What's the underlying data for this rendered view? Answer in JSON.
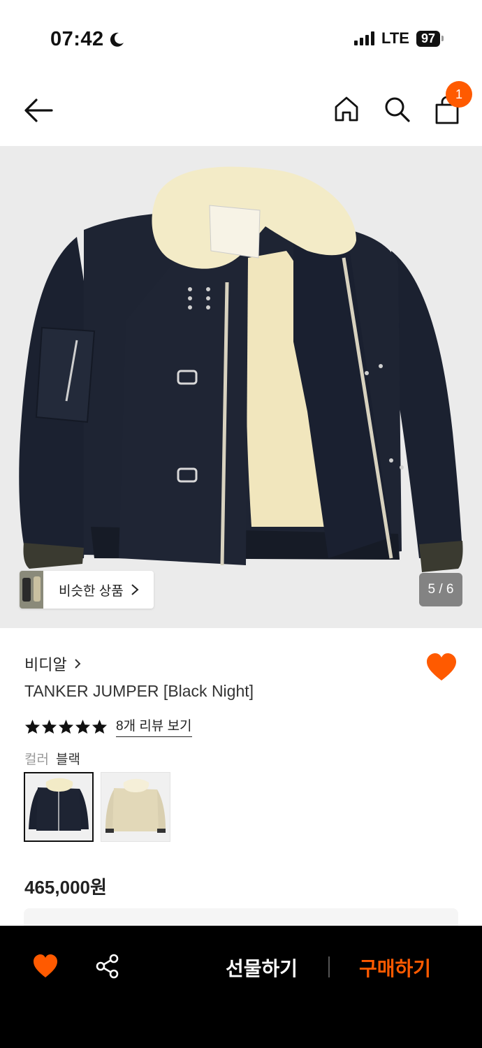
{
  "status_bar": {
    "time": "07:42",
    "network": "LTE",
    "battery": "97"
  },
  "nav": {
    "cart_count": "1",
    "icons": [
      "back-arrow-icon",
      "home-icon",
      "search-icon",
      "shopping-bag-icon"
    ]
  },
  "gallery": {
    "similar_label": "비슷한 상품",
    "counter": "5 / 6",
    "current": 5,
    "total": 6
  },
  "product": {
    "brand": "비디알",
    "title": "TANKER JUMPER [Black Night]",
    "rating": 5,
    "review_link": "8개 리뷰 보기",
    "color_label": "컬러",
    "color_value": "블랙",
    "price": "465,000원",
    "liked": true
  },
  "bottom_bar": {
    "gift_label": "선물하기",
    "buy_label": "구매하기"
  },
  "colors": {
    "accent": "#ff5a00",
    "jacket_body": "#1c2230",
    "shearling": "#f3ebc7",
    "bottom_bar_bg": "#000000"
  }
}
